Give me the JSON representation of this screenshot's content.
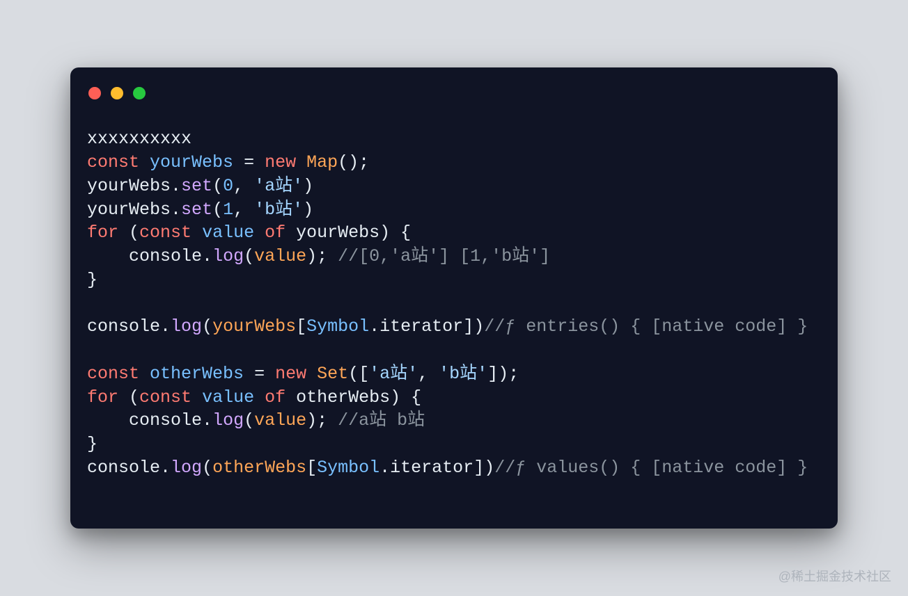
{
  "watermark": "@稀土掘金技术社区",
  "code": {
    "l0": "xxxxxxxxxx",
    "l1": {
      "k1": "const",
      "v1": "yourWebs",
      "op": " = ",
      "k2": "new",
      "cls": "Map",
      "end": "();"
    },
    "l2": {
      "obj": "yourWebs",
      "dot": ".",
      "fn": "set",
      "p1": "(",
      "n": "0",
      "c": ", ",
      "s": "'a站'",
      "p2": ")"
    },
    "l3": {
      "obj": "yourWebs",
      "dot": ".",
      "fn": "set",
      "p1": "(",
      "n": "1",
      "c": ", ",
      "s": "'b站'",
      "p2": ")"
    },
    "l4": {
      "k1": "for",
      "p1": " (",
      "k2": "const",
      "v": "value",
      "of": "of",
      "it": "yourWebs",
      "p2": ") {"
    },
    "l5": {
      "indent": "    ",
      "obj": "console",
      "dot": ".",
      "fn": "log",
      "p1": "(",
      "arg": "value",
      "p2": "); ",
      "cm": "//[0,'a站'] [1,'b站']"
    },
    "l6": "}",
    "l7": "",
    "l8": {
      "obj": "console",
      "dot": ".",
      "fn": "log",
      "p1": "(",
      "a1": "yourWebs",
      "br1": "[",
      "sym": "Symbol",
      "dot2": ".",
      "it": "iterator",
      "br2": "])",
      "cm": "//ƒ entries() { [native code] }"
    },
    "l9": "",
    "l10": {
      "k1": "const",
      "v1": "otherWebs",
      "op": " = ",
      "k2": "new",
      "cls": "Set",
      "p1": "([",
      "s1": "'a站'",
      "c": ", ",
      "s2": "'b站'",
      "p2": "]);"
    },
    "l11": {
      "k1": "for",
      "p1": " (",
      "k2": "const",
      "v": "value",
      "of": "of",
      "it": "otherWebs",
      "p2": ") {"
    },
    "l12": {
      "indent": "    ",
      "obj": "console",
      "dot": ".",
      "fn": "log",
      "p1": "(",
      "arg": "value",
      "p2": "); ",
      "cm": "//a站 b站"
    },
    "l13": "}",
    "l14": {
      "obj": "console",
      "dot": ".",
      "fn": "log",
      "p1": "(",
      "a1": "otherWebs",
      "br1": "[",
      "sym": "Symbol",
      "dot2": ".",
      "it": "iterator",
      "br2": "])",
      "cm": "//ƒ values() { [native code] }"
    }
  }
}
